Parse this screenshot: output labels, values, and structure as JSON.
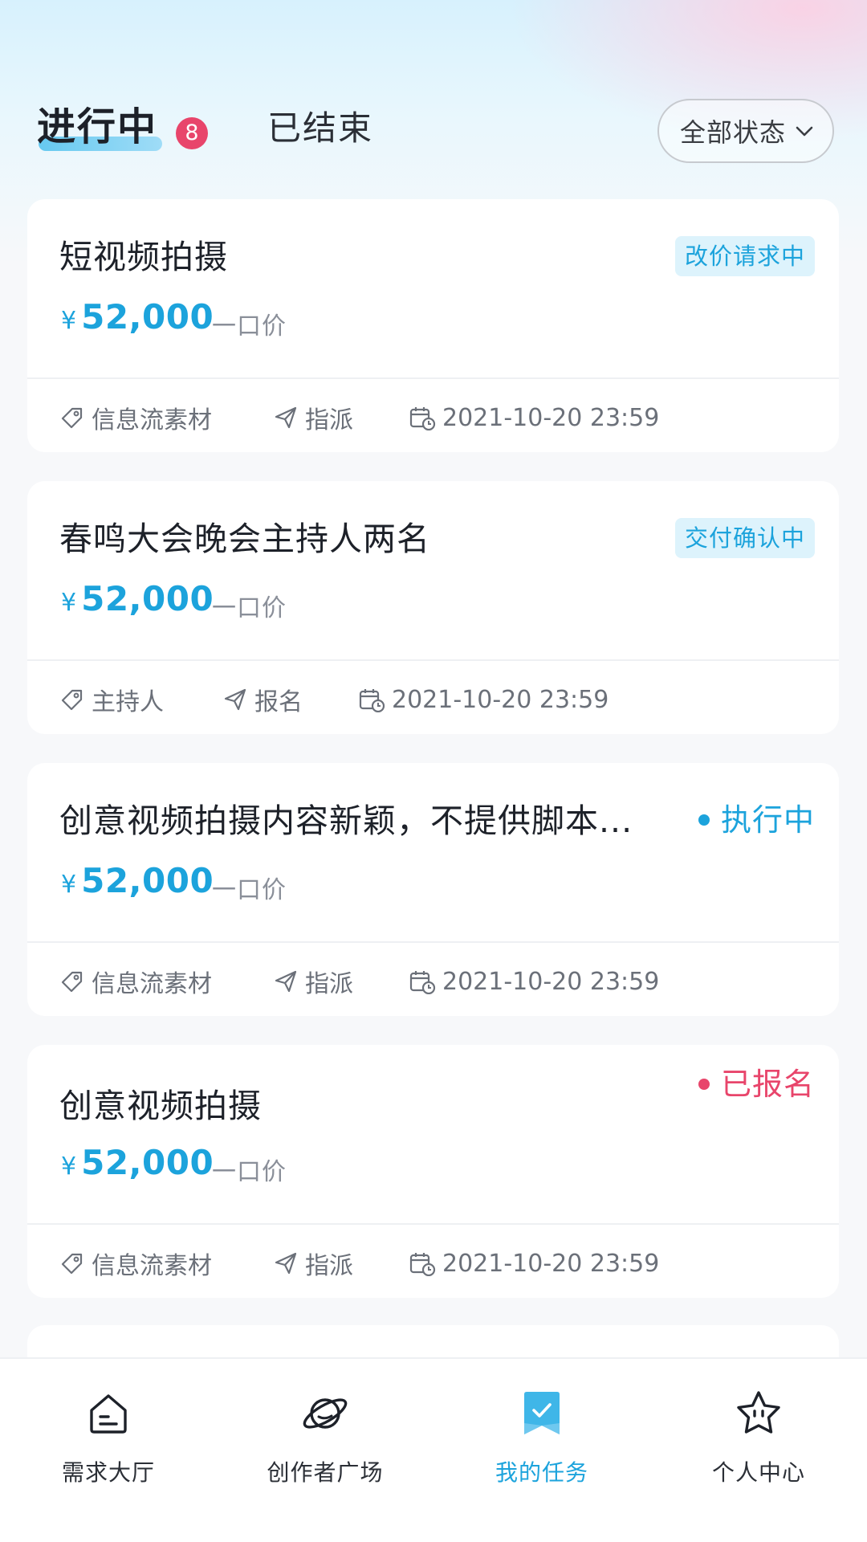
{
  "header": {
    "tabs": [
      {
        "label": "进行中",
        "badge": "8",
        "active": true
      },
      {
        "label": "已结束",
        "active": false
      }
    ],
    "filter": {
      "label": "全部状态",
      "icon": "chevron-down-icon"
    }
  },
  "tasks": [
    {
      "title": "短视频拍摄",
      "currency": "¥",
      "price": "52,000",
      "price_type": "一口价",
      "status": "改价请求中",
      "status_style": "pill",
      "category": "信息流素材",
      "mode": "指派",
      "deadline": "2021-10-20 23:59"
    },
    {
      "title": "春鸣大会晚会主持人两名",
      "currency": "¥",
      "price": "52,000",
      "price_type": "一口价",
      "status": "交付确认中",
      "status_style": "pill",
      "category": "主持人",
      "mode": "报名",
      "deadline": "2021-10-20 23:59"
    },
    {
      "title": "创意视频拍摄内容新颖，不提供脚本...",
      "currency": "¥",
      "price": "52,000",
      "price_type": "一口价",
      "status": "执行中",
      "status_style": "dot",
      "status_color": "#1ca3dc",
      "category": "信息流素材",
      "mode": "指派",
      "deadline": "2021-10-20 23:59"
    },
    {
      "title": "创意视频拍摄",
      "currency": "¥",
      "price": "52,000",
      "price_type": "一口价",
      "status": "已报名",
      "status_style": "dot",
      "status_color": "#e8456b",
      "category": "信息流素材",
      "mode": "指派",
      "deadline": "2021-10-20 23:59"
    }
  ],
  "bottom_nav": [
    {
      "label": "需求大厅",
      "icon": "home-icon",
      "active": false
    },
    {
      "label": "创作者广场",
      "icon": "planet-icon",
      "active": false
    },
    {
      "label": "我的任务",
      "icon": "task-bookmark-icon",
      "active": true
    },
    {
      "label": "个人中心",
      "icon": "star-face-icon",
      "active": false
    }
  ],
  "colors": {
    "accent": "#1ca3dc",
    "badge": "#e8456b",
    "pill_bg": "#ddf3fc"
  }
}
